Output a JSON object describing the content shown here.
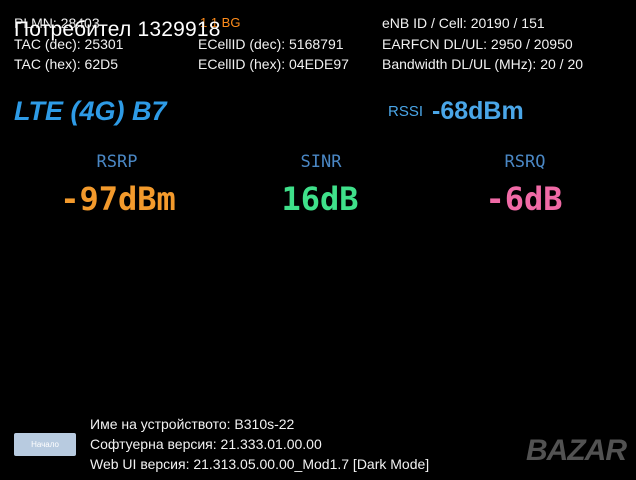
{
  "overlay_title": "Потребител 1329918",
  "cell_info": {
    "left": [
      "PLMN: 28403",
      "TAC (dec): 25301",
      "TAC (hex): 62D5"
    ],
    "middle": [
      "ECellID (dec): 5168791",
      "ECellID (hex): 04EDE97"
    ],
    "band_code": "1 1 BG",
    "right": [
      "eNB ID / Cell: 20190 / 151",
      "EARFCN DL/UL: 2950 / 20950",
      "Bandwidth DL/UL (MHz): 20 / 20"
    ]
  },
  "network": {
    "tech": "LTE (4G) B7",
    "rssi_label": "RSSI",
    "rssi_value": "-68dBm"
  },
  "metrics": [
    {
      "label": "RSRP",
      "value": "-97dBm",
      "color": "#f39a2c"
    },
    {
      "label": "SINR",
      "value": "16dB",
      "color": "#3fe08a"
    },
    {
      "label": "RSRQ",
      "value": "-6dB",
      "color": "#f06aa6"
    }
  ],
  "device": {
    "name": "Име на устройството: B310s-22",
    "software": "Софтуерна версия: 21.333.01.00.00",
    "webui": "Web UI версия: 21.313.05.00.00_Mod1.7 [Dark Mode]"
  },
  "home_button": "Начало",
  "watermark": "BAZAR",
  "colors": {
    "background": "#000000",
    "tech": "#2e9be6",
    "rssi": "#4aa6e8",
    "band_code": "#ff8c1a"
  }
}
